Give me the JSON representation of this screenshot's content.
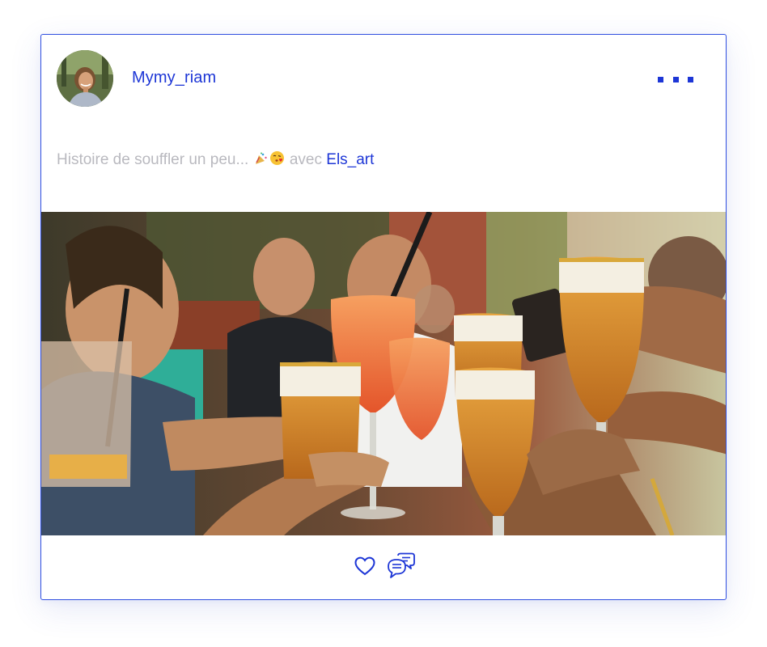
{
  "post": {
    "author": {
      "username": "Mymy_riam",
      "avatar_icon": "profile-photo-icon"
    },
    "menu": {
      "icon": "more-options-icon"
    },
    "caption": {
      "text": "Histoire de souffler un peu...",
      "emojis": [
        "party-popper-emoji",
        "kiss-emoji"
      ],
      "with_label": "avec",
      "mention": "Els_art"
    },
    "photo": {
      "icon": "photo-friends-toasting-drinks"
    },
    "actions": {
      "like_icon": "heart-icon",
      "comment_icon": "comments-icon"
    }
  },
  "colors": {
    "accent": "#1d36d6",
    "muted_text": "#b9b9bf",
    "border": "#2f4fe0"
  }
}
